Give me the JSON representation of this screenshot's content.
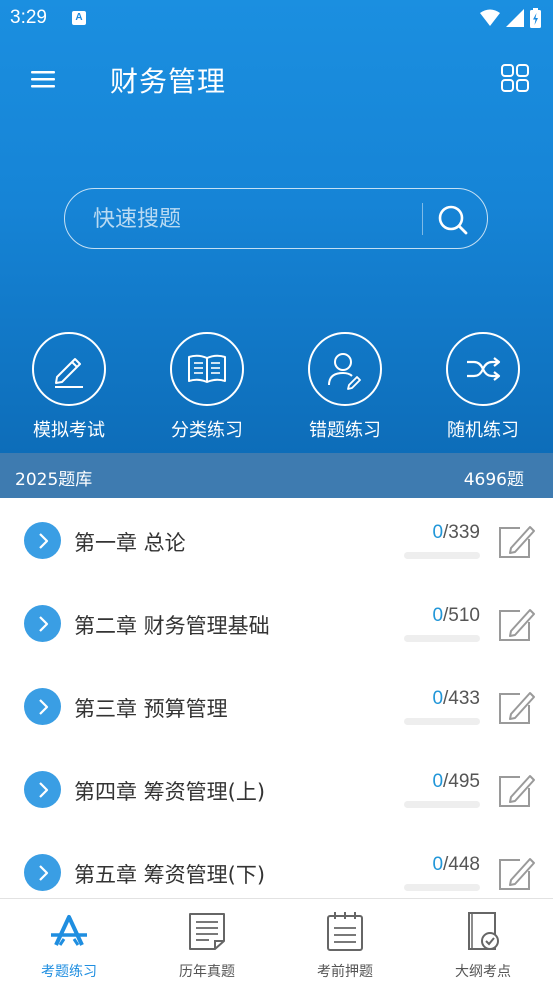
{
  "status_bar": {
    "time": "3:29",
    "notification_badge": "A"
  },
  "header": {
    "title": "财务管理"
  },
  "search": {
    "placeholder": "快速搜题"
  },
  "actions": [
    {
      "label": "模拟考试",
      "icon": "pencil-icon"
    },
    {
      "label": "分类练习",
      "icon": "book-icon"
    },
    {
      "label": "错题练习",
      "icon": "user-edit-icon"
    },
    {
      "label": "随机练习",
      "icon": "shuffle-icon"
    }
  ],
  "bank": {
    "name": "2025题库",
    "total": "4696题"
  },
  "chapters": [
    {
      "title": "第一章 总论",
      "done": "0",
      "total": "/339",
      "progress": 0
    },
    {
      "title": "第二章 财务管理基础",
      "done": "0",
      "total": "/510",
      "progress": 0
    },
    {
      "title": "第三章 预算管理",
      "done": "0",
      "total": "/433",
      "progress": 0
    },
    {
      "title": "第四章 筹资管理(上)",
      "done": "0",
      "total": "/495",
      "progress": 0
    },
    {
      "title": "第五章 筹资管理(下)",
      "done": "0",
      "total": "/448",
      "progress": 0
    }
  ],
  "tabs": [
    {
      "label": "考题练习",
      "icon": "practice-icon",
      "active": true
    },
    {
      "label": "历年真题",
      "icon": "paper-icon",
      "active": false
    },
    {
      "label": "考前押题",
      "icon": "notepad-icon",
      "active": false
    },
    {
      "label": "大纲考点",
      "icon": "outline-check-icon",
      "active": false
    }
  ],
  "colors": {
    "primary": "#1a8ae0",
    "bank_bar": "#3e7bb0",
    "accent": "#2196d8",
    "arrow": "#3a9ee4"
  }
}
